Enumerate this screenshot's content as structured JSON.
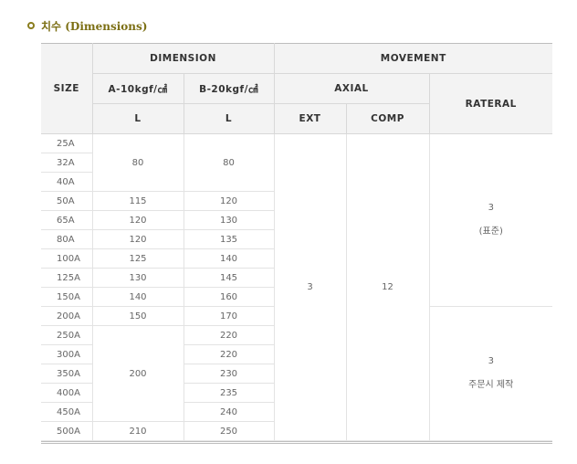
{
  "title": "치수 (Dimensions)",
  "headers": {
    "size": "SIZE",
    "dimension": "DIMENSION",
    "movement": "MOVEMENT",
    "a10": "A-10kgf/㎠",
    "b20": "B-20kgf/㎠",
    "axial": "AXIAL",
    "rateral": "RATERAL",
    "l_a": "L",
    "l_b": "L",
    "ext": "EXT",
    "comp": "COMP"
  },
  "sizes": [
    "25A",
    "32A",
    "40A",
    "50A",
    "65A",
    "80A",
    "100A",
    "125A",
    "150A",
    "200A",
    "250A",
    "300A",
    "350A",
    "400A",
    "450A",
    "500A"
  ],
  "a10": {
    "g25_40": "80",
    "r50": "115",
    "r65": "120",
    "r80": "120",
    "r100": "125",
    "r125": "130",
    "r150": "140",
    "r200": "150",
    "g250_450": "200",
    "r500": "210"
  },
  "b20": {
    "g25_40": "80",
    "r50": "120",
    "r65": "130",
    "r80": "135",
    "r100": "140",
    "r125": "145",
    "r150": "160",
    "r200": "170",
    "r250": "220",
    "r300": "220",
    "r350": "230",
    "r400": "235",
    "r450": "240",
    "r500": "250"
  },
  "movement": {
    "ext": "3",
    "comp": "12",
    "rateral_std_value": "3",
    "rateral_std_note": "(표준)",
    "rateral_order_value": "3",
    "rateral_order_note": "주문시 제작"
  }
}
